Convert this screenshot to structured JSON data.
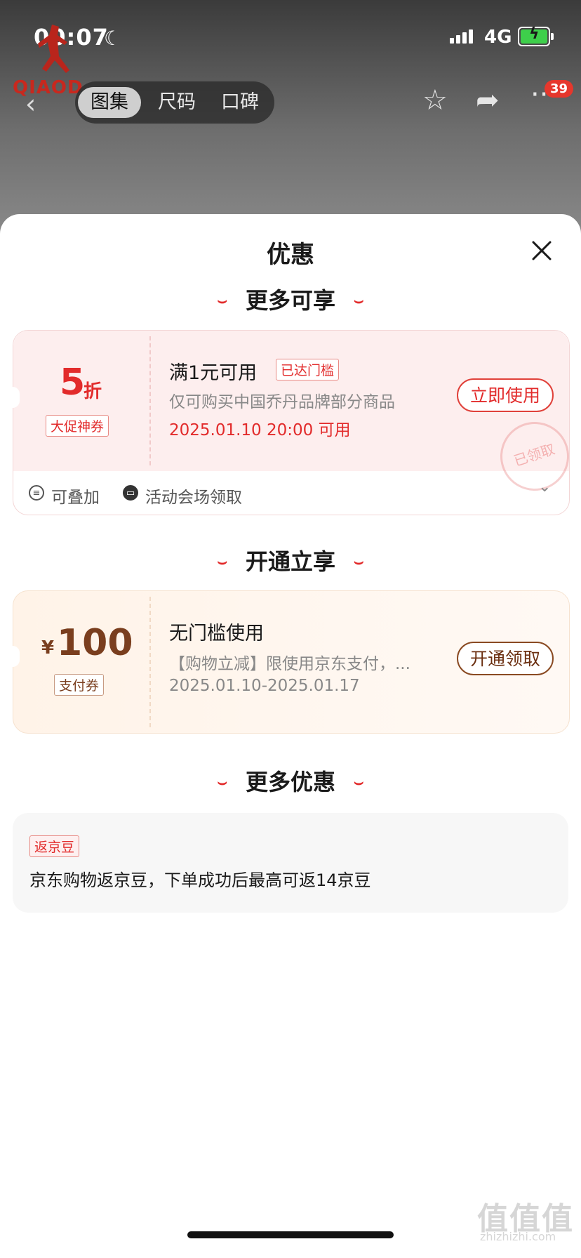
{
  "status_bar": {
    "time": "00:07",
    "network": "4G"
  },
  "header": {
    "brand_text": "QIAOD",
    "tabs": [
      "图集",
      "尺码",
      "口碑"
    ],
    "active_tab": 0,
    "cart_badge": "39"
  },
  "sheet": {
    "title": "优惠",
    "sections": [
      {
        "title": "更多可享"
      },
      {
        "title": "开通立享"
      },
      {
        "title": "更多优惠"
      }
    ]
  },
  "coupon1": {
    "value": "5",
    "unit": "折",
    "type_tag": "大促神券",
    "condition": "满1元可用",
    "status_tag": "已达门槛",
    "description": "仅可购买中国乔丹品牌部分商品",
    "date": "2025.01.10 20:00 可用",
    "button": "立即使用",
    "stamp": "已领取",
    "footer_stack": "可叠加",
    "footer_source": "活动会场领取"
  },
  "coupon2": {
    "currency": "¥",
    "value": "100",
    "type_tag": "支付券",
    "condition": "无门槛使用",
    "description": "【购物立减】限使用京东支付，...",
    "date": "2025.01.10-2025.01.17",
    "button": "开通领取"
  },
  "offer3": {
    "tag": "返京豆",
    "text": "京东购物返京豆，下单成功后最高可返14京豆"
  },
  "watermark": {
    "main": "值值值",
    "sub": "zhizhizhi.com"
  },
  "colors": {
    "accent_red": "#e22b2b",
    "brown": "#7a3e1e"
  }
}
